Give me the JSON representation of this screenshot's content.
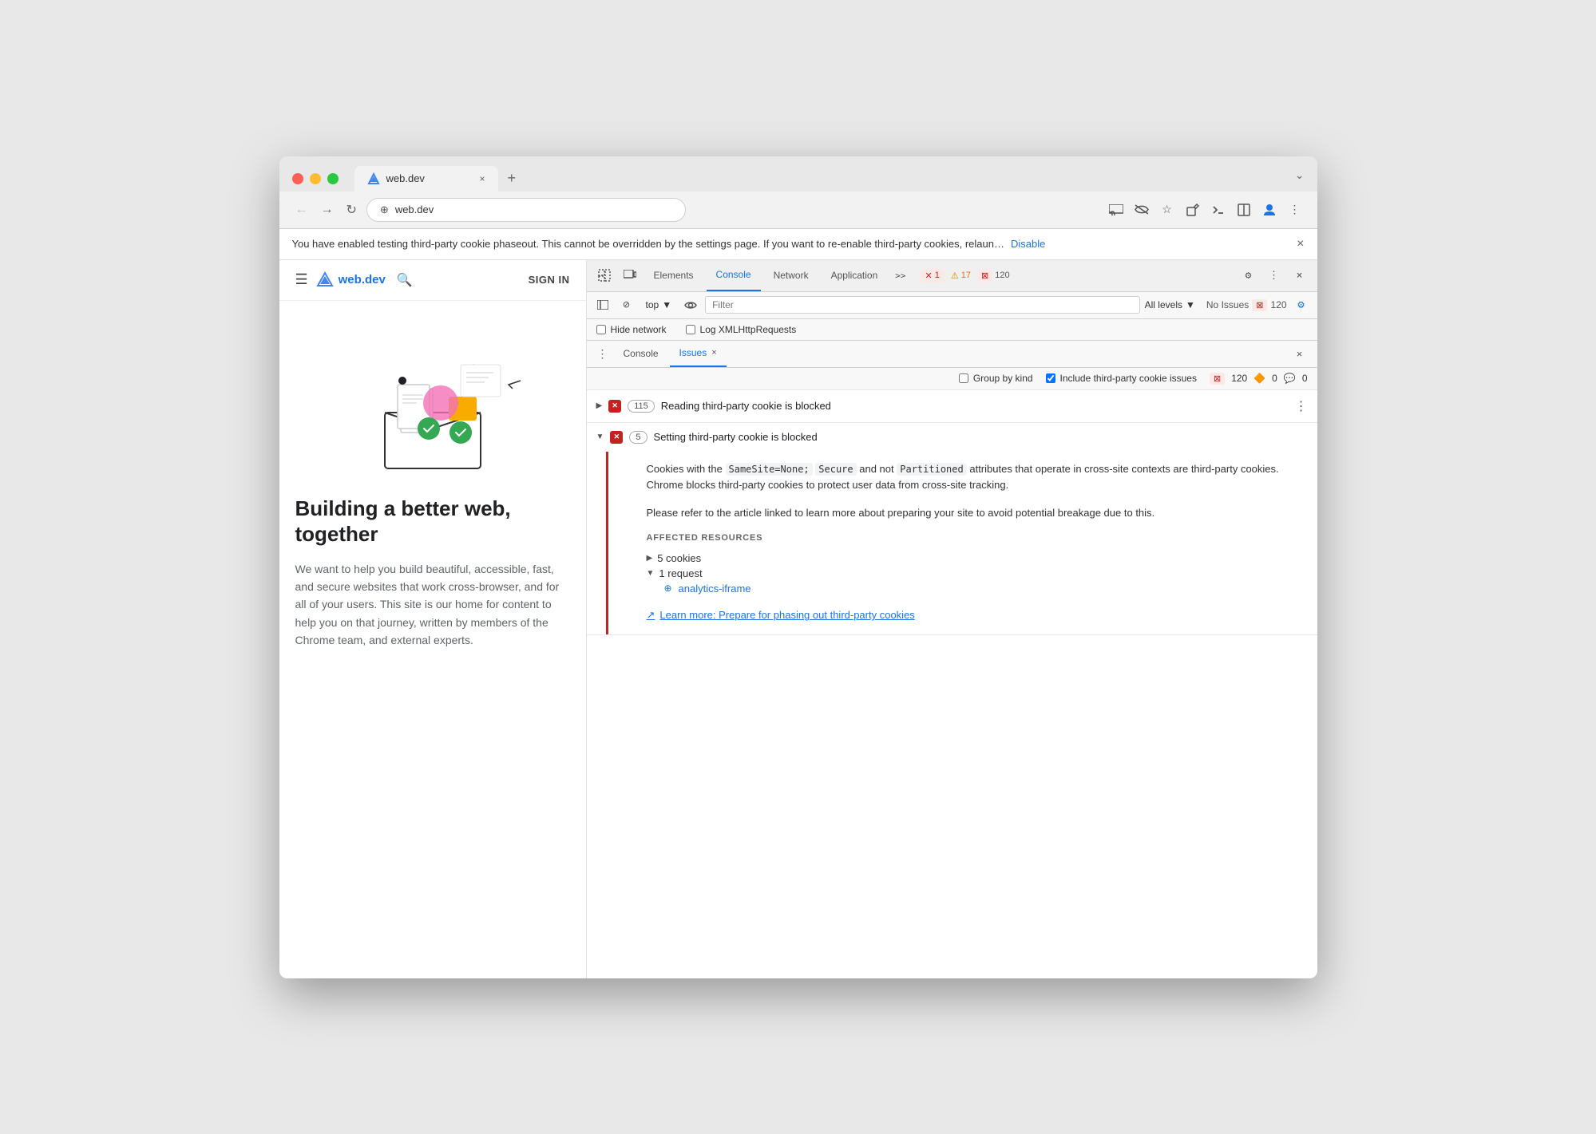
{
  "browser": {
    "tab_title": "web.dev",
    "tab_close": "×",
    "tab_new": "+",
    "address": "web.dev",
    "address_icon": "🌐",
    "chevron_down": "⌄",
    "info_bar_text": "You have enabled testing third-party cookie phaseout. This cannot be overridden by the settings page. If you want to re-enable third-party cookies, relaun…",
    "info_bar_link": "Disable",
    "info_bar_close": "×"
  },
  "website": {
    "hamburger": "☰",
    "logo_text": "web.dev",
    "search_icon": "🔍",
    "sign_in": "SIGN IN",
    "hero_title": "Building a better web, together",
    "hero_desc": "We want to help you build beautiful, accessible, fast, and secure websites that work cross-browser, and for all of your users. This site is our home for content to help you on that journey, written by members of the Chrome team, and external experts."
  },
  "devtools": {
    "tabs": [
      {
        "label": "Elements",
        "active": false
      },
      {
        "label": "Console",
        "active": true
      },
      {
        "label": "Network",
        "active": false
      },
      {
        "label": "Application",
        "active": false
      }
    ],
    "tabs_more": ">>",
    "error_count": "1",
    "warn_count": "17",
    "info_count": "120",
    "close_icon": "×",
    "settings_icon": "⚙",
    "more_icon": "⋮",
    "context_label": "top",
    "filter_placeholder": "Filter",
    "levels_label": "All levels",
    "no_issues_label": "No Issues",
    "no_issues_count": "120",
    "hide_network_label": "Hide network",
    "log_xhr_label": "Log XMLHttpRequests",
    "subtabs": [
      {
        "label": "Console",
        "active": false
      },
      {
        "label": "Issues",
        "active": true,
        "closeable": true
      }
    ],
    "issues_toolbar": {
      "group_by_kind_label": "Group by kind",
      "include_third_party_label": "Include third-party cookie issues",
      "include_third_party_checked": true,
      "badge_error": "120",
      "badge_warn": "0",
      "badge_info": "0"
    },
    "issues": [
      {
        "expanded": false,
        "icon": "✕",
        "count": "115",
        "title": "Reading third-party cookie is blocked",
        "has_expand": true
      },
      {
        "expanded": true,
        "icon": "✕",
        "count": "5",
        "title": "Setting third-party cookie is blocked",
        "body": {
          "paragraph1": "Cookies with the SameSite=None; Secure and not Partitioned attributes that operate in cross-site contexts are third-party cookies. Chrome blocks third-party cookies to protect user data from cross-site tracking.",
          "paragraph1_code": [
            "SameSite=None;",
            "Secure",
            "Partitioned"
          ],
          "paragraph2": "Please refer to the article linked to learn more about preparing your site to avoid potential breakage due to this.",
          "affected_resources_title": "AFFECTED RESOURCES",
          "resources": [
            {
              "type": "expandable",
              "label": "5 cookies",
              "expanded": false
            },
            {
              "type": "expandable",
              "label": "1 request",
              "expanded": true,
              "children": [
                {
                  "label": "analytics-iframe",
                  "type": "link",
                  "icon": "🌐"
                }
              ]
            }
          ],
          "learn_more_link": "Learn more: Prepare for phasing out third-party cookies"
        }
      }
    ]
  }
}
